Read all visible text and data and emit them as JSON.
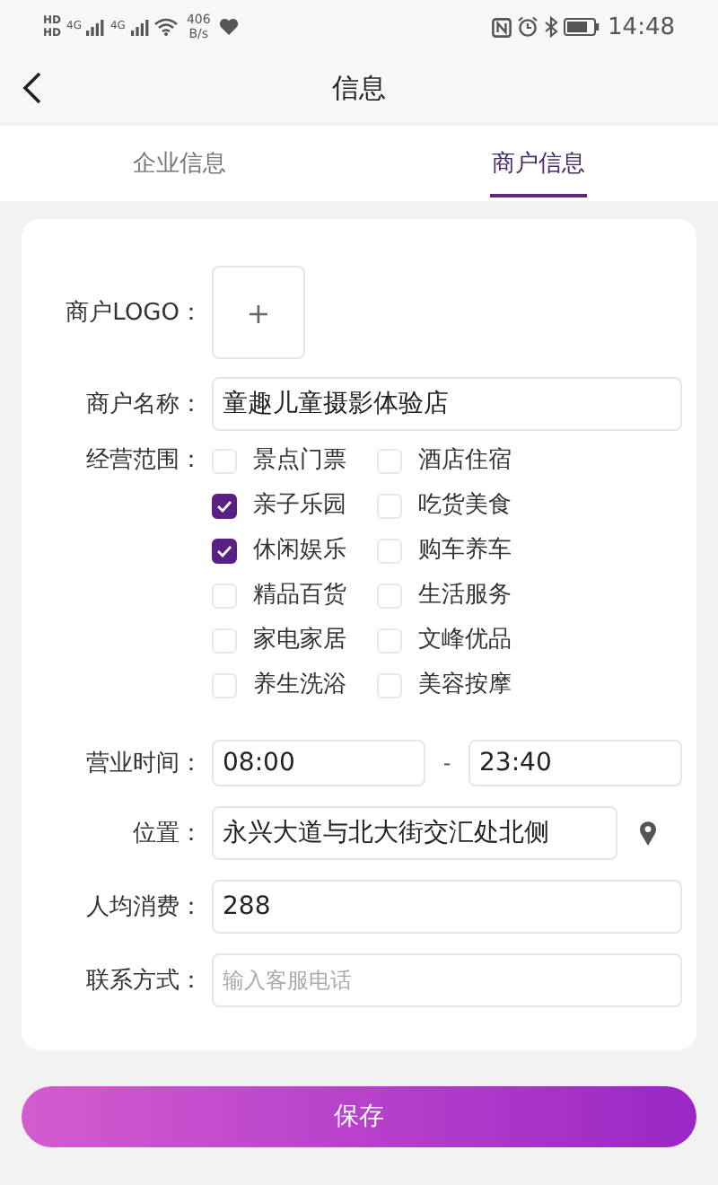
{
  "status_bar": {
    "sim_labels": [
      "HD",
      "HD"
    ],
    "network_labels": [
      "4G",
      "4G"
    ],
    "speed": "406",
    "speed_unit": "B/s",
    "time": "14:48"
  },
  "header": {
    "title": "信息"
  },
  "tabs": [
    {
      "label": "企业信息",
      "selected": false
    },
    {
      "label": "商户信息",
      "selected": true
    }
  ],
  "form": {
    "logo_label": "商户LOGO：",
    "logo_add": "+",
    "name_label": "商户名称：",
    "name_value": "童趣儿童摄影体验店",
    "scope_label": "经营范围：",
    "scopes": [
      {
        "label": "景点门票",
        "checked": false
      },
      {
        "label": "酒店住宿",
        "checked": false
      },
      {
        "label": "亲子乐园",
        "checked": true
      },
      {
        "label": "吃货美食",
        "checked": false
      },
      {
        "label": "休闲娱乐",
        "checked": true
      },
      {
        "label": "购车养车",
        "checked": false
      },
      {
        "label": "精品百货",
        "checked": false
      },
      {
        "label": "生活服务",
        "checked": false
      },
      {
        "label": "家电家居",
        "checked": false
      },
      {
        "label": "文峰优品",
        "checked": false
      },
      {
        "label": "养生洗浴",
        "checked": false
      },
      {
        "label": "美容按摩",
        "checked": false
      }
    ],
    "hours_label": "营业时间：",
    "hours_start": "08:00",
    "hours_sep": "-",
    "hours_end": "23:40",
    "location_label": "位置：",
    "location_value": "永兴大道与北大街交汇处北侧",
    "price_label": "人均消费：",
    "price_value": "288",
    "contact_label": "联系方式：",
    "contact_placeholder": "输入客服电话"
  },
  "save_button": "保存"
}
